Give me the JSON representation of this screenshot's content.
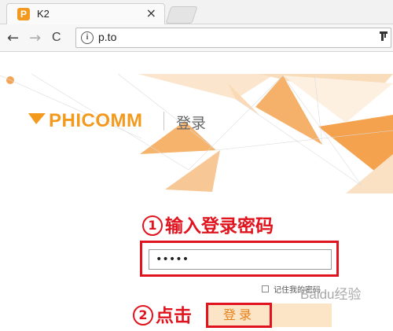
{
  "browser": {
    "tab": {
      "favicon_letter": "P",
      "title": "K2",
      "close": "×"
    },
    "nav": {
      "back": "←",
      "forward": "→",
      "reload": "C"
    },
    "omnibox": {
      "info": "i",
      "url": "p.to"
    }
  },
  "page": {
    "logo_text": "PHICOMM",
    "title": "登录",
    "step1": {
      "number": "1",
      "text": "输入登录密码"
    },
    "password_value": "•••••",
    "remember_label": "记住我的密码",
    "step2": {
      "number": "2",
      "text": "点击"
    },
    "login_button": "登录",
    "watermark": "Baidu经验"
  },
  "colors": {
    "brand_orange": "#f39a1e",
    "annotation_red": "#e0141e",
    "button_bg": "#fbe5c6"
  }
}
